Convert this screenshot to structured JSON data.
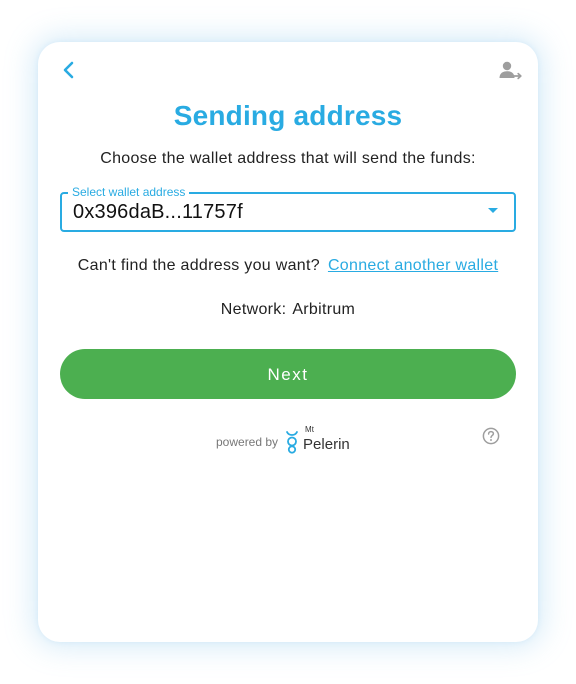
{
  "header": {
    "back_icon": "chevron-left-icon",
    "account_icon": "account-switch-icon"
  },
  "title": "Sending address",
  "subtitle": "Choose the wallet address that will send the funds:",
  "wallet_select": {
    "label": "Select wallet address",
    "value": "0x396daB...11757f",
    "caret_icon": "caret-down-icon"
  },
  "cant_find": {
    "text": "Can't find the address you want?",
    "link": "Connect another wallet"
  },
  "network": {
    "label": "Network:",
    "value": "Arbitrum"
  },
  "next_button": "Next",
  "footer": {
    "powered_by": "powered by",
    "logo_superscript": "Mt",
    "logo_name": "Pelerin",
    "help_icon": "question-circle-icon"
  },
  "colors": {
    "accent": "#29abe2",
    "primary_button": "#4caf50",
    "text": "#222222"
  }
}
